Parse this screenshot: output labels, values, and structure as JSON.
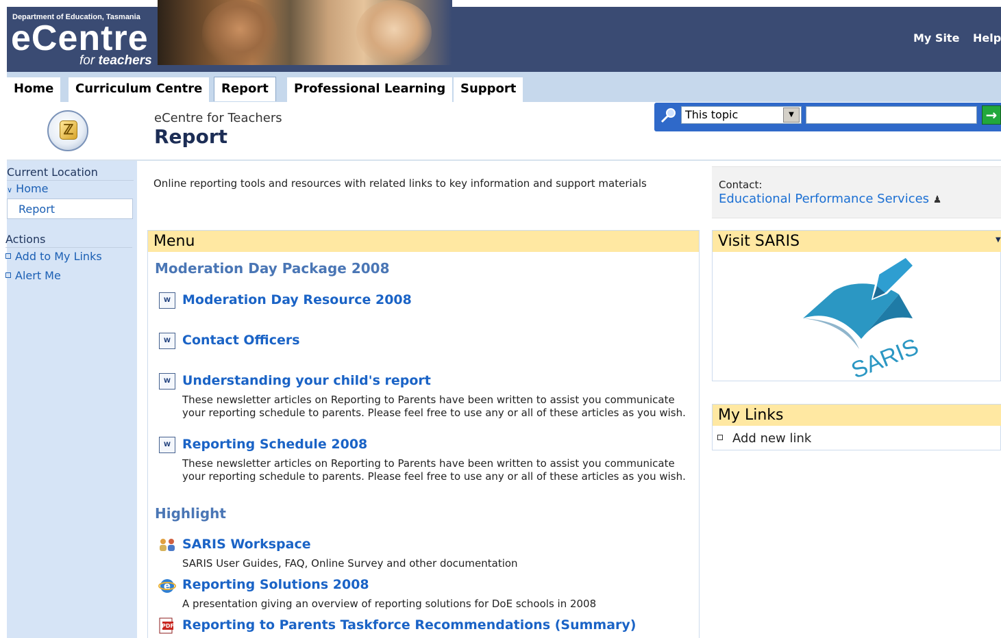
{
  "header": {
    "department": "Department of Education, Tasmania",
    "logo_main": "eCentre",
    "logo_sub_for": "for",
    "logo_sub_teachers": "teachers",
    "my_site": "My Site",
    "help": "Help"
  },
  "tabs": [
    {
      "label": "Home"
    },
    {
      "label": "Curriculum Centre"
    },
    {
      "label": "Report",
      "selected": true
    },
    {
      "label": "Professional Learning"
    },
    {
      "label": "Support"
    }
  ],
  "title": {
    "site_name": "eCentre for Teachers",
    "page_title": "Report"
  },
  "search": {
    "scope": "This topic",
    "value": "",
    "go_icon": "arrow-right-icon"
  },
  "leftnav": {
    "current_location": "Current Location",
    "home": "Home",
    "report": "Report",
    "actions": "Actions",
    "add_to_my_links": "Add to My Links",
    "alert_me": "Alert Me"
  },
  "description": "Online reporting tools and resources with related links to key information and support materials",
  "contact": {
    "label": "Contact:",
    "name": "Educational Performance Services"
  },
  "menu": {
    "heading": "Menu",
    "section1": "Moderation Day Package 2008",
    "items1": [
      {
        "label": "Moderation Day Resource 2008",
        "icon": "word-doc-icon"
      },
      {
        "label": "Contact Officers",
        "icon": "word-doc-icon"
      },
      {
        "label": "Understanding your child's report",
        "icon": "word-doc-icon",
        "note": "These newsletter articles on Reporting to Parents have been written to assist you communicate your reporting schedule to parents. Please feel free to use any or all of these articles as you wish."
      },
      {
        "label": "Reporting Schedule 2008",
        "icon": "word-doc-icon",
        "note": "These newsletter articles on Reporting to Parents have been written to assist you communicate your reporting schedule to parents. Please feel free to use any or all of these articles as you wish."
      }
    ],
    "section2": "Highlight",
    "items2": [
      {
        "label": "SARIS Workspace",
        "icon": "workspace-people-icon",
        "note": "SARIS User Guides, FAQ, Online Survey and other documentation"
      },
      {
        "label": "Reporting Solutions 2008",
        "icon": "internet-explorer-icon",
        "note": "A presentation giving an overview of reporting solutions for DoE schools in 2008"
      },
      {
        "label": "Reporting to Parents Taskforce Recommendations (Summary)",
        "icon": "pdf-doc-icon"
      }
    ]
  },
  "saris": {
    "heading": "Visit SARIS",
    "logo_text": "SARIS"
  },
  "my_links": {
    "heading": "My Links",
    "add_new": "Add new link"
  },
  "colors": {
    "header_bg": "#3a4b73",
    "tabbar_bg": "#c6d8ec",
    "panel_head": "#ffe8a2",
    "link": "#1a63c6",
    "leftnav_bg": "#d6e4f6"
  }
}
